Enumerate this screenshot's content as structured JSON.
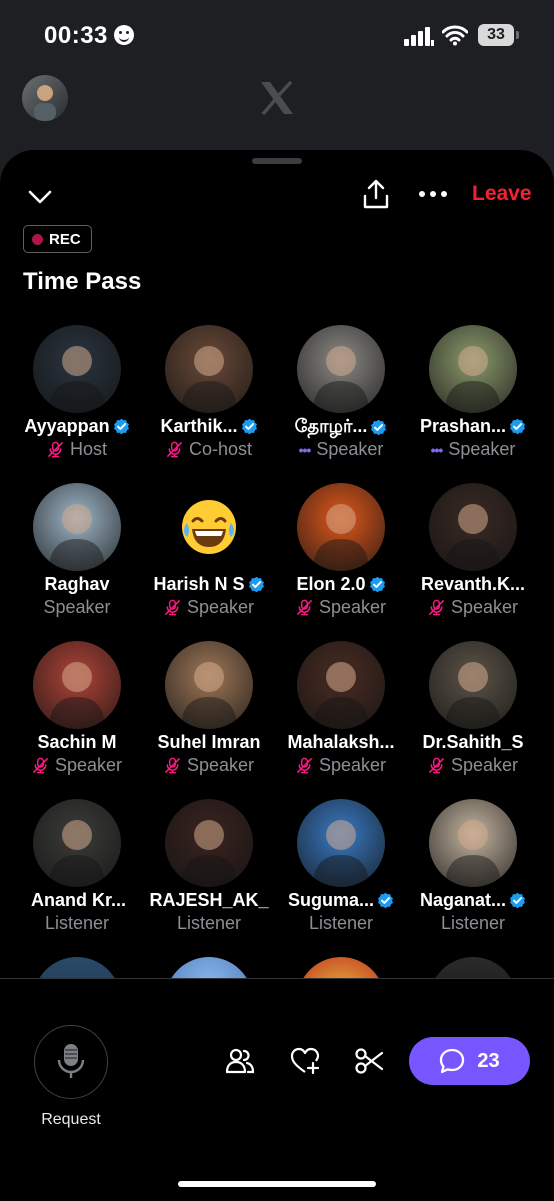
{
  "status_bar": {
    "time": "00:33",
    "battery": "33"
  },
  "space": {
    "rec_label": "REC",
    "title": "Time Pass",
    "leave_label": "Leave"
  },
  "participants": [
    {
      "name": "Ayyappan",
      "role": "Host",
      "verified": true,
      "muted": true,
      "avatar_color": "#2a3440"
    },
    {
      "name": "Karthik...",
      "role": "Co-host",
      "verified": true,
      "muted": true,
      "avatar_color": "#6a4a38"
    },
    {
      "name": "தோழர்...",
      "role": "Speaker",
      "verified": true,
      "muted": false,
      "avatar_color": "#8c8a86"
    },
    {
      "name": "Prashan...",
      "role": "Speaker",
      "verified": true,
      "muted": false,
      "avatar_color": "#8c9b6e"
    },
    {
      "name": "Raghav",
      "role": "Speaker",
      "verified": false,
      "muted": false,
      "avatar_color": "#9fb7c9"
    },
    {
      "name": "Harish N S",
      "role": "Speaker",
      "verified": true,
      "muted": true,
      "avatar_color": "#000000"
    },
    {
      "name": "Elon 2.0",
      "role": "Speaker",
      "verified": true,
      "muted": true,
      "avatar_color": "#e0581c"
    },
    {
      "name": "Revanth.K...",
      "role": "Speaker",
      "verified": false,
      "muted": true,
      "avatar_color": "#3a2a24"
    },
    {
      "name": "Sachin M",
      "role": "Speaker",
      "verified": false,
      "muted": true,
      "avatar_color": "#b04438"
    },
    {
      "name": "Suhel Imran",
      "role": "Speaker",
      "verified": false,
      "muted": true,
      "avatar_color": "#a07858"
    },
    {
      "name": "Mahalaksh...",
      "role": "Speaker",
      "verified": false,
      "muted": true,
      "avatar_color": "#4a2c24"
    },
    {
      "name": "Dr.Sahith_S",
      "role": "Speaker",
      "verified": false,
      "muted": true,
      "avatar_color": "#5c5448"
    },
    {
      "name": "Anand Kr...",
      "role": "Listener",
      "verified": false,
      "muted": false,
      "apple_prefix": "",
      "avatar_color": "#3c3c3a"
    },
    {
      "name": "RAJESH_AK_",
      "role": "Listener",
      "verified": false,
      "muted": false,
      "avatar_color": "#3a2420"
    },
    {
      "name": "Suguma...",
      "role": "Listener",
      "verified": true,
      "muted": false,
      "avatar_color": "#3a7ac4"
    },
    {
      "name": "Naganat...",
      "role": "Listener",
      "verified": true,
      "muted": false,
      "avatar_color": "#c4b4a0"
    }
  ],
  "bottom": {
    "request_label": "Request",
    "chat_count": "23"
  },
  "colors": {
    "accent": "#7856ff",
    "leave": "#f4212e",
    "verified": "#1d9bf0",
    "mute": "#f91880"
  }
}
